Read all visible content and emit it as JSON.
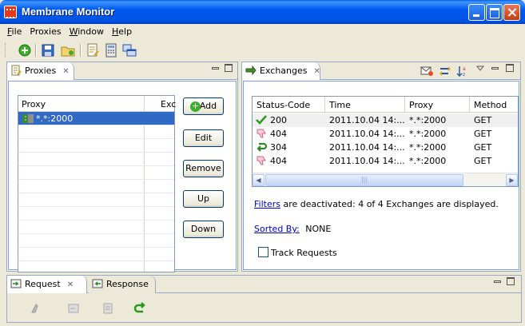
{
  "window": {
    "title": "Membrane Monitor"
  },
  "menu": [
    {
      "label": "File",
      "accel": "F",
      "rest": "ile"
    },
    {
      "label": "Proxies",
      "accel": "",
      "rest": "Proxies"
    },
    {
      "label": "Window",
      "accel": "W",
      "rest": "indow"
    },
    {
      "label": "Help",
      "accel": "H",
      "rest": "elp"
    }
  ],
  "toolbar": [
    "add-proxy-icon",
    "save-icon",
    "open-folder-icon",
    "edit-rules-icon",
    "calculator-icon",
    "windows-icon"
  ],
  "proxies_panel": {
    "tab_label": "Proxies",
    "columns": [
      "Proxy",
      "Exc"
    ],
    "rows": [
      {
        "proxy": "*.*:2000",
        "selected": true
      }
    ],
    "buttons": {
      "add": "Add",
      "edit": "Edit",
      "remove": "Remove",
      "up": "Up",
      "down": "Down"
    }
  },
  "exchanges_panel": {
    "tab_label": "Exchanges",
    "columns": [
      "Status-Code",
      "Time",
      "Proxy",
      "Method"
    ],
    "rows": [
      {
        "status": "200",
        "icon": "check-icon",
        "time": "2011.10.04 14:...",
        "proxy": "*.*:2000",
        "method": "GET"
      },
      {
        "status": "404",
        "icon": "thumbs-down-icon",
        "time": "2011.10.04 14:...",
        "proxy": "*.*:2000",
        "method": "GET"
      },
      {
        "status": "304",
        "icon": "return-arrow-icon",
        "time": "2011.10.04 14:...",
        "proxy": "*.*:2000",
        "method": "GET"
      },
      {
        "status": "404",
        "icon": "thumbs-down-icon",
        "time": "2011.10.04 14:...",
        "proxy": "*.*:2000",
        "method": "GET"
      }
    ],
    "filters_link": "Filters",
    "filters_text": "are deactivated:   4 of 4 Exchanges are displayed.",
    "sorted_by_link": "Sorted By:",
    "sorted_by_value": "NONE",
    "track_requests_label": "Track Requests",
    "track_requests_checked": false
  },
  "bottom_panel": {
    "tabs": [
      "Request",
      "Response"
    ]
  },
  "colors": {
    "selection": "#316ac5",
    "titlebar": "#0054e3",
    "link": "#0000cc"
  }
}
